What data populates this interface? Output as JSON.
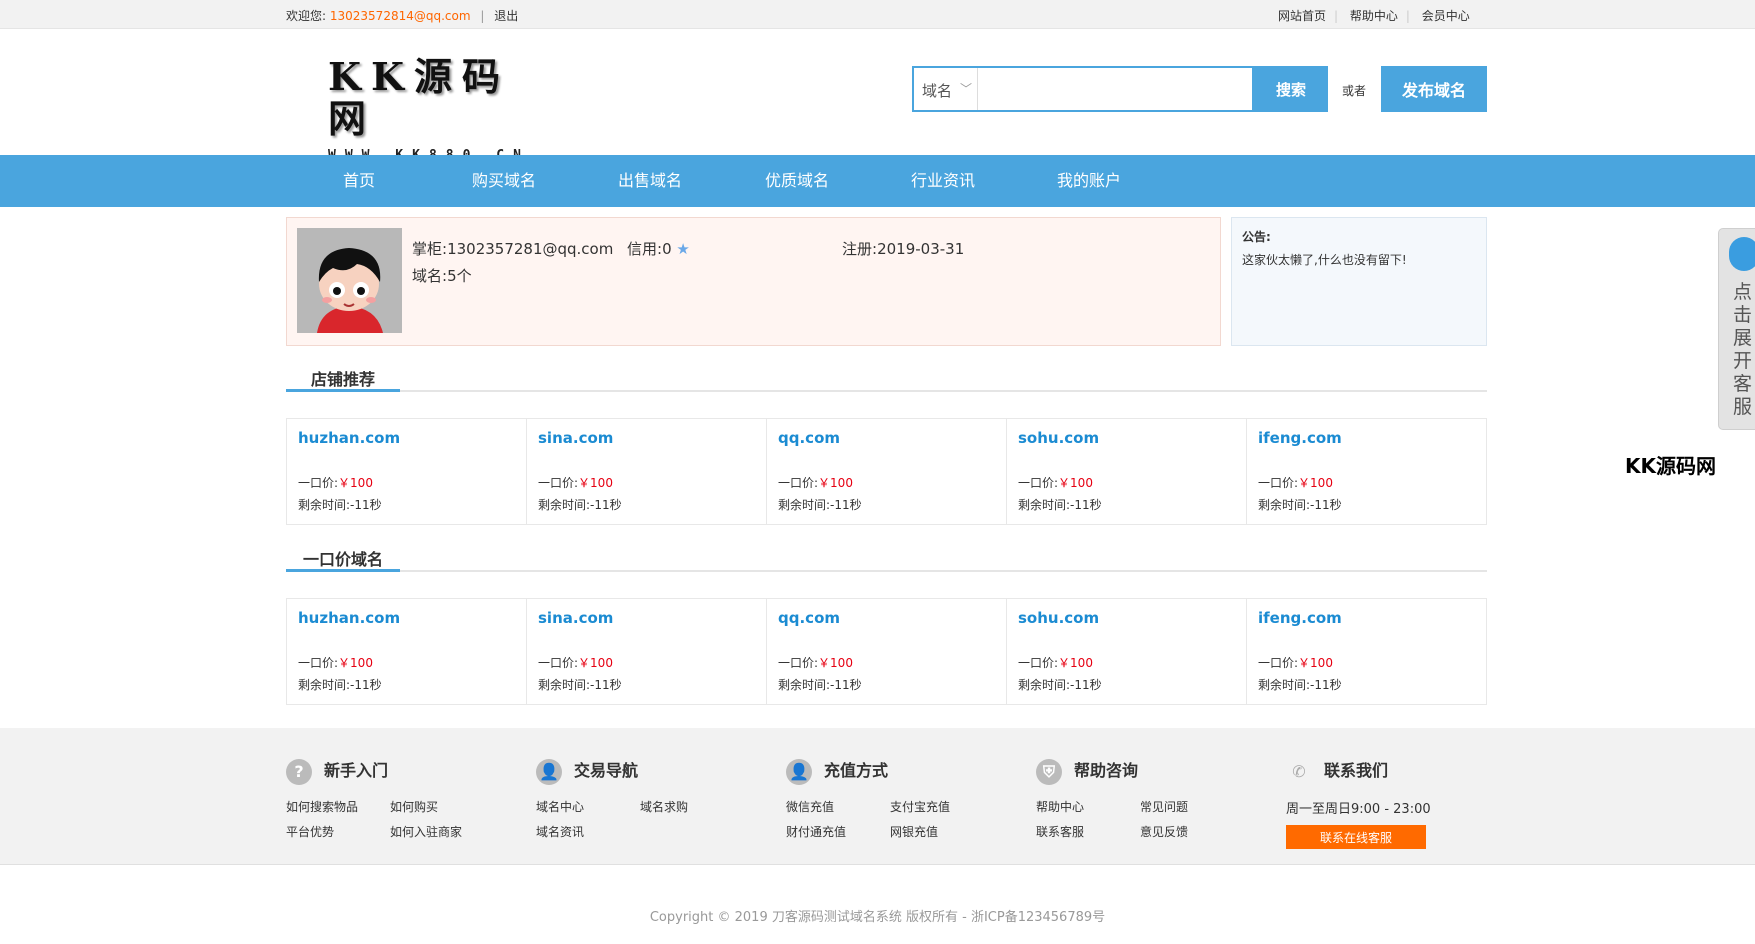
{
  "topbar": {
    "welcome": "欢迎您:",
    "email": "13023572814@qq.com",
    "sep": "|",
    "logout": "退出",
    "links": [
      "网站首页",
      "帮助中心",
      "会员中心"
    ]
  },
  "logo": {
    "title": "KK源码网",
    "subtitle": "WWW.KK880.CN"
  },
  "search": {
    "select": "域名",
    "placeholder": "",
    "button": "搜索",
    "or": "或者",
    "publish": "发布域名"
  },
  "nav": [
    "首页",
    "购买域名",
    "出售域名",
    "优质域名",
    "行业资讯",
    "我的账户"
  ],
  "shop": {
    "owner_label": "掌柜:",
    "owner": "1302357281@qq.com",
    "credit_label": "信用:",
    "credit": "0",
    "reg_label": "注册:",
    "reg": "2019-03-31",
    "domains_label": "域名:",
    "domains": "5个"
  },
  "notice": {
    "title": "公告:",
    "content": "这家伙太懒了,什么也没有留下!"
  },
  "sections": {
    "recommend": "店铺推荐",
    "fixed": "一口价域名"
  },
  "labels": {
    "price": "一口价:",
    "remain": "剩余时间:"
  },
  "recommend_cards": [
    {
      "domain": "huzhan.com",
      "price": "￥100",
      "remain": "-11秒"
    },
    {
      "domain": "sina.com",
      "price": "￥100",
      "remain": "-11秒"
    },
    {
      "domain": "qq.com",
      "price": "￥100",
      "remain": "-11秒"
    },
    {
      "domain": "sohu.com",
      "price": "￥100",
      "remain": "-11秒"
    },
    {
      "domain": "ifeng.com",
      "price": "￥100",
      "remain": "-11秒"
    }
  ],
  "fixed_cards": [
    {
      "domain": "huzhan.com",
      "price": "￥100",
      "remain": "-11秒"
    },
    {
      "domain": "sina.com",
      "price": "￥100",
      "remain": "-11秒"
    },
    {
      "domain": "qq.com",
      "price": "￥100",
      "remain": "-11秒"
    },
    {
      "domain": "sohu.com",
      "price": "￥100",
      "remain": "-11秒"
    },
    {
      "domain": "ifeng.com",
      "price": "￥100",
      "remain": "-11秒"
    }
  ],
  "footer": {
    "cols": [
      {
        "title": "新手入门",
        "icon": "question-icon",
        "links": [
          "如何搜索物品",
          "如何购买",
          "平台优势",
          "如何入驻商家"
        ]
      },
      {
        "title": "交易导航",
        "icon": "user-trade-icon",
        "links": [
          "域名中心",
          "域名求购",
          "域名资讯"
        ]
      },
      {
        "title": "充值方式",
        "icon": "user-pay-icon",
        "links": [
          "微信充值",
          "支付宝充值",
          "财付通充值",
          "网银充值"
        ]
      },
      {
        "title": "帮助咨询",
        "icon": "shield-icon",
        "links": [
          "帮助中心",
          "常见问题",
          "联系客服",
          "意见反馈"
        ]
      }
    ],
    "contact": {
      "title": "联系我们",
      "icon": "phone-icon",
      "time": "周一至周日9:00 - 23:00",
      "button": "联系在线客服"
    },
    "copyright": "Copyright © 2019 刀客源码测试域名系统 版权所有 - 浙ICP备123456789号"
  },
  "side": {
    "text": "点击展开客服"
  },
  "watermark": "KK源码网",
  "colors": {
    "accent": "#4aa5de",
    "price": "#e60012",
    "orange": "#ff6a00"
  }
}
